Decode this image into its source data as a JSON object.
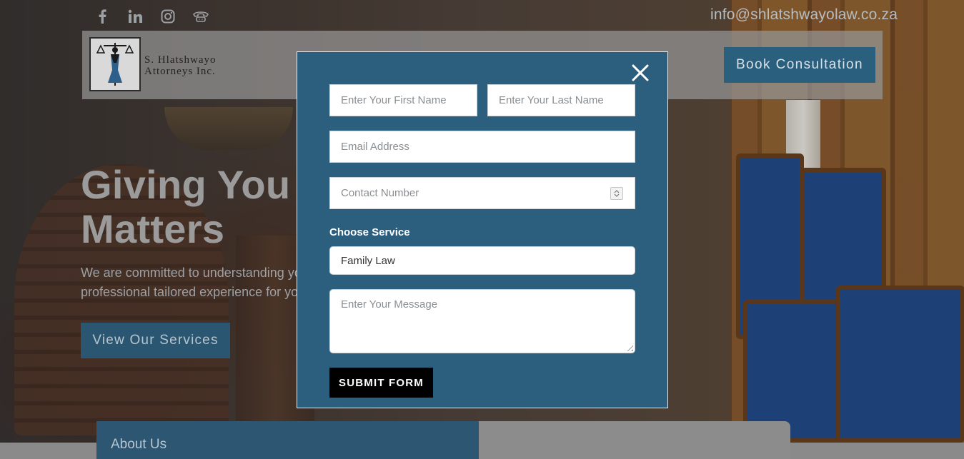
{
  "topbar": {
    "social": [
      {
        "icon": "facebook-icon",
        "glyph": "f"
      },
      {
        "icon": "linkedin-icon",
        "glyph": "in"
      },
      {
        "icon": "instagram-icon",
        "glyph": "◎"
      },
      {
        "icon": "phone-icon",
        "glyph": "☎"
      }
    ],
    "email": "info@shlatshwayolaw.co.za"
  },
  "header": {
    "logo_line1": "S. Hlatshwayo",
    "logo_line2": "Attorneys Inc.",
    "book_button": "Book Consultation"
  },
  "hero": {
    "title_line1": "Giving You A",
    "title_line2": "Matters",
    "subtitle_line1": "We are committed to understanding yo",
    "subtitle_line2": "professional tailored experience for you",
    "services_button": "View Our Services"
  },
  "about": {
    "label": "About Us"
  },
  "modal": {
    "close_glyph": "✕",
    "first_name_placeholder": "Enter Your First Name",
    "last_name_placeholder": "Enter Your Last Name",
    "email_placeholder": "Email Address",
    "phone_placeholder": "Contact Number",
    "service_label": "Choose Service",
    "service_value": "Family Law",
    "message_placeholder": "Enter Your Message",
    "submit_label": "SUBMIT FORM"
  },
  "colors": {
    "modal_bg": "#2c5f7e",
    "accent_button": "#2b5f7e",
    "submit_bg": "#000000"
  }
}
